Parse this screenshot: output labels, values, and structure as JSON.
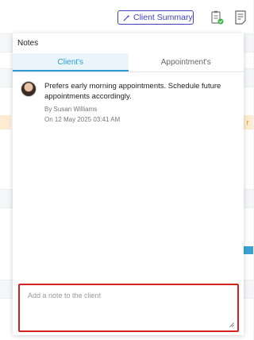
{
  "header": {
    "client_summary_label": "Client Summary",
    "clipboard_icon": "clipboard-check-icon",
    "notes_icon": "notes-icon",
    "accent_color": "#3f3fbf"
  },
  "notes_panel": {
    "title": "Notes",
    "tabs": [
      {
        "label": "Client's",
        "active": true
      },
      {
        "label": "Appointment's",
        "active": false
      }
    ],
    "notes": [
      {
        "text": "Prefers early morning appointments. Schedule future appointments accordingly.",
        "author": "By Susan Williams",
        "date": "On 12 May 2025 03:41 AM"
      }
    ],
    "input": {
      "placeholder": "Add a note to the client",
      "value": ""
    },
    "tab_active_color": "#2c9bd1",
    "input_highlight_color": "#d62121"
  }
}
